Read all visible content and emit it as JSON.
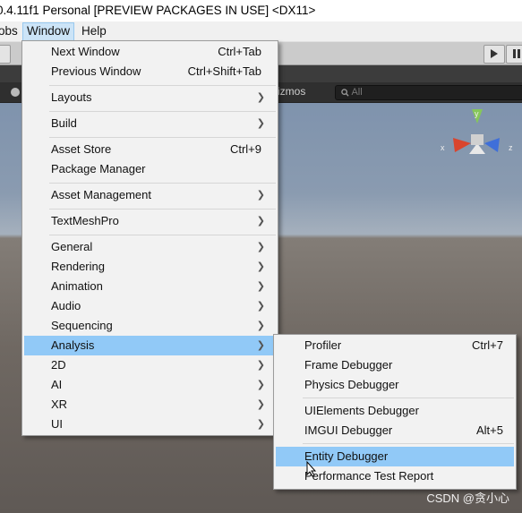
{
  "window": {
    "title": "0.4.11f1 Personal [PREVIEW PACKAGES IN USE] <DX11>"
  },
  "menubar": {
    "items": [
      "obs",
      "Window",
      "Help"
    ]
  },
  "scene": {
    "gizmos_label": "izmos",
    "search_placeholder": "All",
    "axis_x": "x",
    "axis_y": "y",
    "axis_z": "z"
  },
  "window_menu": {
    "items": [
      {
        "label": "Next Window",
        "shortcut": "Ctrl+Tab"
      },
      {
        "label": "Previous Window",
        "shortcut": "Ctrl+Shift+Tab"
      },
      {
        "label": "Layouts",
        "submenu": true
      },
      {
        "label": "Build",
        "submenu": true
      },
      {
        "label": "Asset Store",
        "shortcut": "Ctrl+9"
      },
      {
        "label": "Package Manager"
      },
      {
        "label": "Asset Management",
        "submenu": true
      },
      {
        "label": "TextMeshPro",
        "submenu": true
      },
      {
        "label": "General",
        "submenu": true
      },
      {
        "label": "Rendering",
        "submenu": true
      },
      {
        "label": "Animation",
        "submenu": true
      },
      {
        "label": "Audio",
        "submenu": true
      },
      {
        "label": "Sequencing",
        "submenu": true
      },
      {
        "label": "Analysis",
        "submenu": true,
        "highlighted": true
      },
      {
        "label": "2D",
        "submenu": true
      },
      {
        "label": "AI",
        "submenu": true
      },
      {
        "label": "XR",
        "submenu": true
      },
      {
        "label": "UI",
        "submenu": true
      }
    ]
  },
  "analysis_menu": {
    "items": [
      {
        "label": "Profiler",
        "shortcut": "Ctrl+7"
      },
      {
        "label": "Frame Debugger"
      },
      {
        "label": "Physics Debugger"
      },
      {
        "label": "UIElements Debugger"
      },
      {
        "label": "IMGUI Debugger",
        "shortcut": "Alt+5"
      },
      {
        "label": "Entity Debugger",
        "highlighted": true
      },
      {
        "label": "Performance Test Report"
      }
    ]
  },
  "watermark": "CSDN @贪小心",
  "colors": {
    "highlight": "#91c9f7",
    "menu_bg": "#f2f2f2"
  }
}
